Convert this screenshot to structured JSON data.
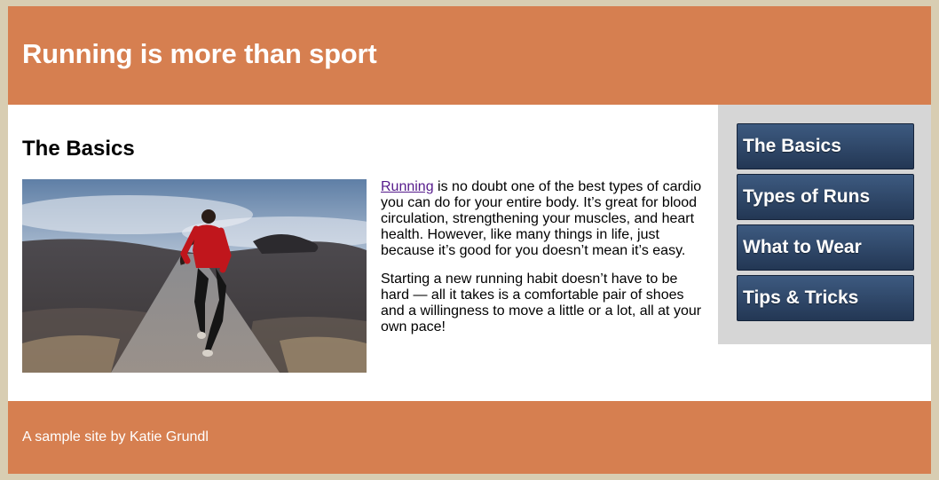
{
  "header": {
    "title": "Running is more than sport"
  },
  "main": {
    "heading": "The Basics",
    "image_subject": "woman running on a road",
    "paragraph1": {
      "link": "Running",
      "text": " is no doubt one of the best types of cardio you can do for your entire body. It’s great for blood circulation, strengthening your muscles, and heart health. However, like many things in life, just because it’s good for you doesn’t mean it’s easy."
    },
    "paragraph2": "Starting a new running habit doesn’t have to be hard — all it takes is a comfortable pair of shoes and a willingness to move a little or a lot, all at your own pace!"
  },
  "sidebar": {
    "items": [
      {
        "label": "The Basics"
      },
      {
        "label": "Types of Runs"
      },
      {
        "label": "What to Wear"
      },
      {
        "label": "Tips & Tricks"
      }
    ]
  },
  "footer": {
    "text": "A sample site by Katie Grundl"
  },
  "colors": {
    "background": "#d8cdb2",
    "header": "#d67f50",
    "sidebar": "#d6d6d6",
    "nav_button": "#2f4668",
    "link": "#551a8b"
  }
}
